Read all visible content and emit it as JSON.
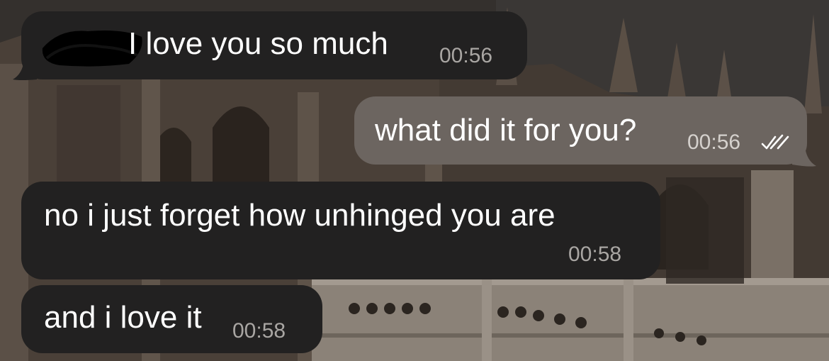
{
  "conversation": {
    "messages": [
      {
        "direction": "incoming",
        "sender_redacted": true,
        "text": "I love you so much",
        "time": "00:56"
      },
      {
        "direction": "outgoing",
        "text": "what did it for you?",
        "time": "00:56",
        "status_icon": "double-check-read-icon"
      },
      {
        "direction": "incoming",
        "text": "no i just forget how unhinged you are",
        "time": "00:58"
      },
      {
        "direction": "incoming",
        "text": "and i love it",
        "time": "00:58"
      }
    ]
  },
  "colors": {
    "incoming_bubble": "#222121",
    "outgoing_bubble": "#6c6560",
    "message_text": "#ffffff",
    "timestamp_incoming": "#a9a6a3",
    "timestamp_outgoing": "#d5d1cd",
    "redaction": "#000000"
  },
  "background": {
    "description_icon": "gothic-cathedral-wallpaper"
  }
}
